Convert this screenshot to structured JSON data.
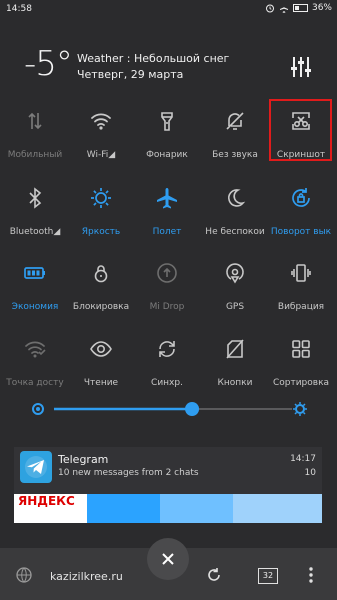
{
  "status_bar": {
    "time": "14:58",
    "battery": "36%"
  },
  "header": {
    "temperature": "-5°",
    "weather": "Weather : Небольшой снег",
    "date": "Четверг, 29 марта"
  },
  "tiles": [
    {
      "label": "Мобильный",
      "icon": "mobile-data-icon",
      "state": "off"
    },
    {
      "label": "Wi-Fi◢",
      "icon": "wifi-icon",
      "state": "off"
    },
    {
      "label": "Фонарик",
      "icon": "flashlight-icon",
      "state": "off"
    },
    {
      "label": "Без звука",
      "icon": "bell-off-icon",
      "state": "off"
    },
    {
      "label": "Скриншот",
      "icon": "screenshot-icon",
      "state": "off"
    },
    {
      "label": "Bluetooth◢",
      "icon": "bluetooth-icon",
      "state": "off"
    },
    {
      "label": "Яркость",
      "icon": "brightness-icon",
      "state": "on"
    },
    {
      "label": "Полет",
      "icon": "airplane-icon",
      "state": "on"
    },
    {
      "label": "Не беспокои",
      "icon": "moon-icon",
      "state": "off"
    },
    {
      "label": "Поворот вык",
      "icon": "rotation-lock-icon",
      "state": "on"
    },
    {
      "label": "Экономия",
      "icon": "battery-saver-icon",
      "state": "on"
    },
    {
      "label": "Блокировка",
      "icon": "lock-icon",
      "state": "off"
    },
    {
      "label": "Mi Drop",
      "icon": "mi-drop-icon",
      "state": "disabled"
    },
    {
      "label": "GPS",
      "icon": "gps-icon",
      "state": "off"
    },
    {
      "label": "Вибрация",
      "icon": "vibration-icon",
      "state": "off"
    },
    {
      "label": "Точка досту",
      "icon": "hotspot-icon",
      "state": "disabled"
    },
    {
      "label": "Чтение",
      "icon": "eye-icon",
      "state": "off"
    },
    {
      "label": "Синхр.",
      "icon": "sync-icon",
      "state": "off"
    },
    {
      "label": "Кнопки",
      "icon": "buttons-off-icon",
      "state": "off"
    },
    {
      "label": "Сортировка",
      "icon": "grid-icon",
      "state": "off"
    }
  ],
  "brightness": {
    "level": 0.58
  },
  "notification": {
    "app": "Telegram",
    "time": "14:17",
    "message": "10 new messages from 2 chats",
    "count": "10",
    "ad_brand": "ЯНДЕКС"
  },
  "browser": {
    "url": "kazizilkree.ru",
    "tab_count": "32"
  },
  "colors": {
    "accent": "#2f9df0",
    "highlight": "#e01b1b"
  }
}
